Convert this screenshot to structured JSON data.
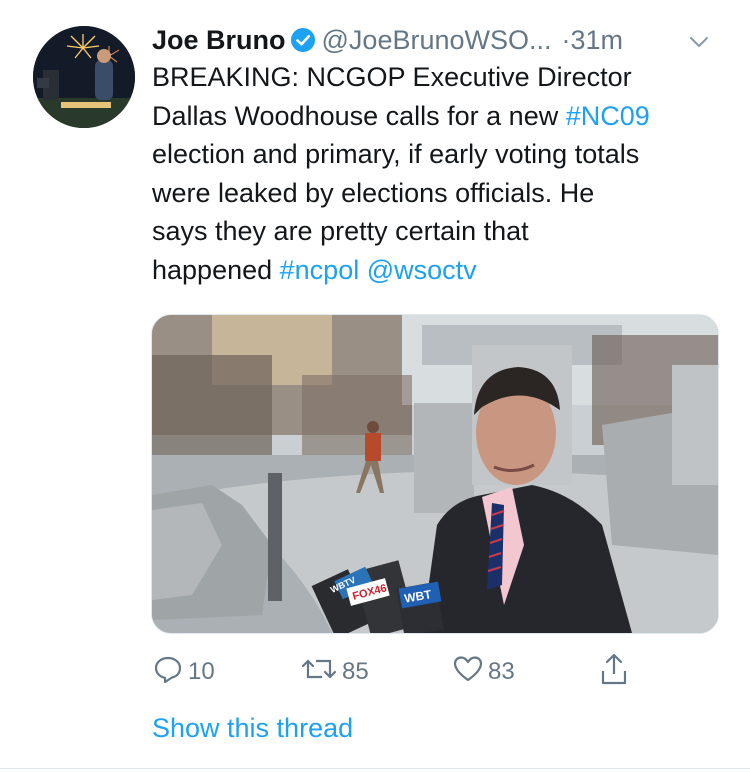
{
  "author": {
    "name": "Joe Bruno",
    "handle": "@JoeBrunoWSO...",
    "separator": "·",
    "time": "31m"
  },
  "tweet": {
    "lines": [
      [
        {
          "t": "BREAKING: NCGOP Executive Director",
          "link": false
        }
      ],
      [
        {
          "t": "Dallas Woodhouse calls for a new ",
          "link": false
        },
        {
          "t": "#NC09",
          "link": true
        }
      ],
      [
        {
          "t": "election and primary, if early voting totals",
          "link": false
        }
      ],
      [
        {
          "t": "were leaked by elections officials. He",
          "link": false
        }
      ],
      [
        {
          "t": "says they are pretty certain that",
          "link": false
        }
      ],
      [
        {
          "t": "happened ",
          "link": false
        },
        {
          "t": "#ncpol",
          "link": true
        },
        {
          "t": " ",
          "link": false
        },
        {
          "t": "@wsoctv",
          "link": true
        }
      ]
    ]
  },
  "media": {
    "mic_flag_1": "WBTV",
    "mic_flag_2": "FOX46",
    "mic_flag_3": "WBT"
  },
  "actions": {
    "reply_count": "10",
    "retweet_count": "85",
    "like_count": "83"
  },
  "show_thread": "Show this thread",
  "icons": {
    "verified": "verified-badge-icon",
    "chevron": "chevron-down-icon",
    "reply": "reply-icon",
    "retweet": "retweet-icon",
    "like": "heart-icon",
    "share": "share-icon"
  },
  "colors": {
    "link": "#1da1f2",
    "secondary": "#657786",
    "text": "#14171a"
  }
}
